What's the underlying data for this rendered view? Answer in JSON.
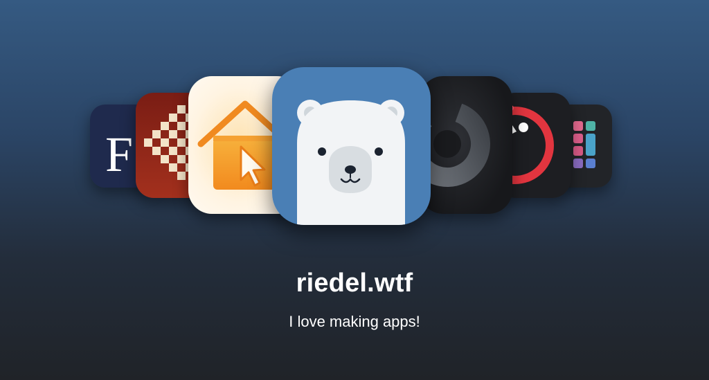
{
  "site": {
    "title": "riedel.wtf",
    "tagline": "I love making apps!"
  },
  "apps": [
    {
      "icon": "serif-letter-app-icon",
      "color": "#1f2a4d"
    },
    {
      "icon": "pixel-grid-app-icon",
      "color": "#8e2418"
    },
    {
      "icon": "home-cursor-app-icon",
      "color": "#f0a030"
    },
    {
      "icon": "polar-bear-app-icon",
      "color": "#4a7fb5"
    },
    {
      "icon": "dark-dial-app-icon",
      "color": "#1c1d20"
    },
    {
      "icon": "red-ring-app-icon",
      "color": "#e2353f"
    },
    {
      "icon": "color-grid-app-icon",
      "color": "#e46a8f"
    }
  ],
  "colors": {
    "background_top": "#355a82",
    "background_bottom": "#202328"
  }
}
